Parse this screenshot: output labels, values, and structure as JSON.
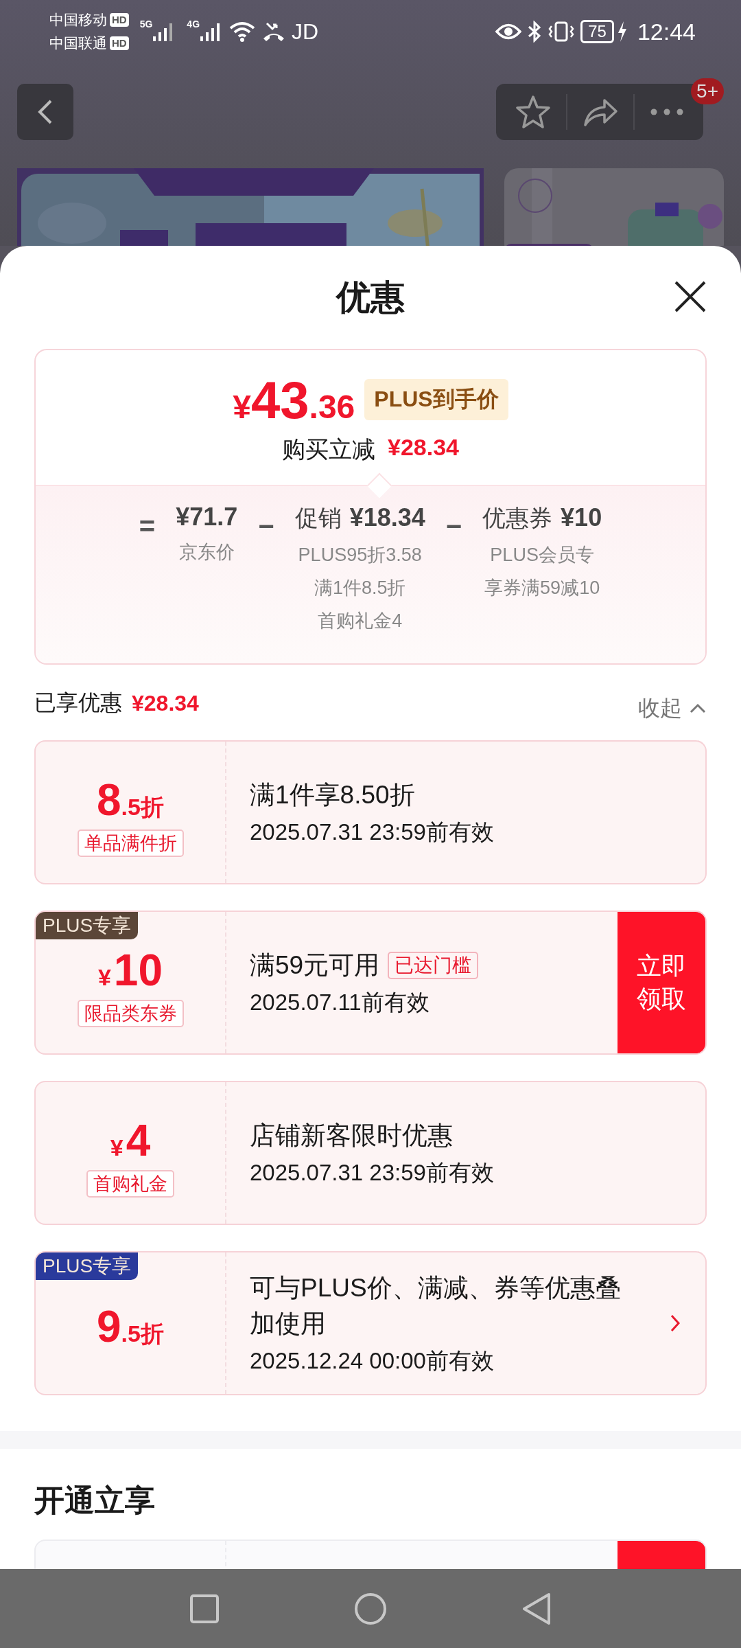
{
  "status_bar": {
    "carriers": [
      {
        "name": "中国移动",
        "hd": "HD"
      },
      {
        "name": "中国联通",
        "hd": "HD"
      }
    ],
    "networks": [
      "5G",
      "4G"
    ],
    "app": "JD",
    "battery": "75",
    "time": "12:44"
  },
  "top_bar": {
    "badge": "5+"
  },
  "sheet": {
    "title": "优惠"
  },
  "price_box": {
    "currency": "¥",
    "price_int": "43",
    "price_dec": ".36",
    "price_tag": "PLUS到手价",
    "saving_label": "购买立减",
    "saving_value": "¥28.34",
    "breakdown": [
      {
        "kind": "sign",
        "text": "="
      },
      {
        "kind": "term",
        "amount": "¥71.7",
        "notes": [
          "京东价"
        ]
      },
      {
        "kind": "sign",
        "text": "−"
      },
      {
        "kind": "term",
        "label": "促销",
        "amount": "¥18.34",
        "notes": [
          "PLUS95折3.58",
          "满1件8.5折",
          "首购礼金4"
        ]
      },
      {
        "kind": "sign",
        "text": "−"
      },
      {
        "kind": "term",
        "label": "优惠券",
        "amount": "¥10",
        "notes": [
          "PLUS会员专",
          "享券满59减10"
        ]
      }
    ]
  },
  "summary": {
    "label": "已享优惠",
    "value": "¥28.34",
    "toggle": "收起"
  },
  "coupons": [
    {
      "amount_main": "8",
      "amount_suffix": ".5折",
      "tag": "单品满件折",
      "title": "满1件享8.50折",
      "validity": "2025.07.31 23:59前有效",
      "more": false
    },
    {
      "badge": {
        "text": "PLUS专享",
        "color": "#5b4638"
      },
      "amount_prefix": "¥",
      "amount_main": "10",
      "tag": "限品类东券",
      "title": "满59元可用",
      "status_tag": "已达门槛",
      "validity": "2025.07.11前有效",
      "action": "立即领取",
      "more": false
    },
    {
      "amount_prefix": "¥",
      "amount_main": "4",
      "tag": "首购礼金",
      "title": "店铺新客限时优惠",
      "validity": "2025.07.31 23:59前有效",
      "more": false
    },
    {
      "badge": {
        "text": "PLUS专享",
        "color": "#2a3a9c"
      },
      "amount_main": "9",
      "amount_suffix": ".5折",
      "title": "可与PLUS价、满减、券等优惠叠加使用",
      "validity": "2025.12.24 00:00前有效",
      "more": true
    }
  ],
  "section2": {
    "title": "开通立享"
  }
}
